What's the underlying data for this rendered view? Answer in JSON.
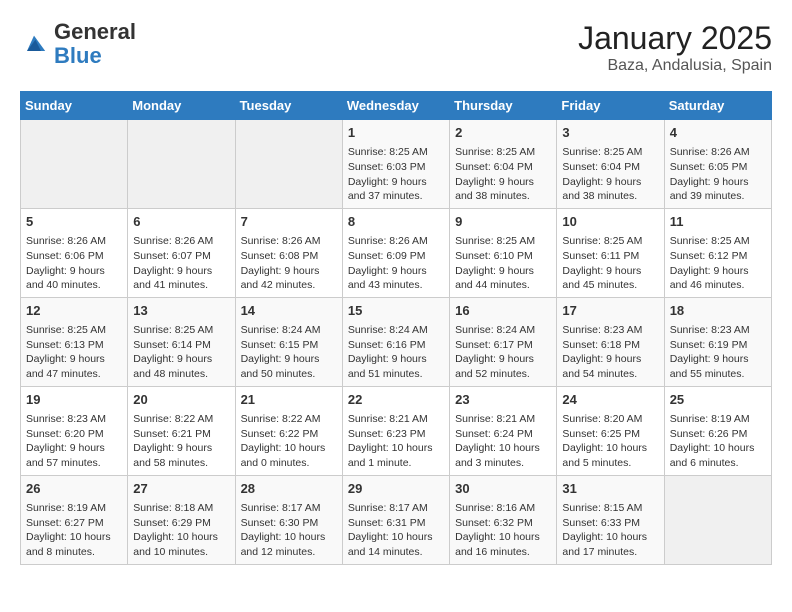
{
  "header": {
    "logo_general": "General",
    "logo_blue": "Blue",
    "title": "January 2025",
    "subtitle": "Baza, Andalusia, Spain"
  },
  "weekdays": [
    "Sunday",
    "Monday",
    "Tuesday",
    "Wednesday",
    "Thursday",
    "Friday",
    "Saturday"
  ],
  "weeks": [
    [
      {
        "day": "",
        "sunrise": "",
        "sunset": "",
        "daylight": ""
      },
      {
        "day": "",
        "sunrise": "",
        "sunset": "",
        "daylight": ""
      },
      {
        "day": "",
        "sunrise": "",
        "sunset": "",
        "daylight": ""
      },
      {
        "day": "1",
        "sunrise": "Sunrise: 8:25 AM",
        "sunset": "Sunset: 6:03 PM",
        "daylight": "Daylight: 9 hours and 37 minutes."
      },
      {
        "day": "2",
        "sunrise": "Sunrise: 8:25 AM",
        "sunset": "Sunset: 6:04 PM",
        "daylight": "Daylight: 9 hours and 38 minutes."
      },
      {
        "day": "3",
        "sunrise": "Sunrise: 8:25 AM",
        "sunset": "Sunset: 6:04 PM",
        "daylight": "Daylight: 9 hours and 38 minutes."
      },
      {
        "day": "4",
        "sunrise": "Sunrise: 8:26 AM",
        "sunset": "Sunset: 6:05 PM",
        "daylight": "Daylight: 9 hours and 39 minutes."
      }
    ],
    [
      {
        "day": "5",
        "sunrise": "Sunrise: 8:26 AM",
        "sunset": "Sunset: 6:06 PM",
        "daylight": "Daylight: 9 hours and 40 minutes."
      },
      {
        "day": "6",
        "sunrise": "Sunrise: 8:26 AM",
        "sunset": "Sunset: 6:07 PM",
        "daylight": "Daylight: 9 hours and 41 minutes."
      },
      {
        "day": "7",
        "sunrise": "Sunrise: 8:26 AM",
        "sunset": "Sunset: 6:08 PM",
        "daylight": "Daylight: 9 hours and 42 minutes."
      },
      {
        "day": "8",
        "sunrise": "Sunrise: 8:26 AM",
        "sunset": "Sunset: 6:09 PM",
        "daylight": "Daylight: 9 hours and 43 minutes."
      },
      {
        "day": "9",
        "sunrise": "Sunrise: 8:25 AM",
        "sunset": "Sunset: 6:10 PM",
        "daylight": "Daylight: 9 hours and 44 minutes."
      },
      {
        "day": "10",
        "sunrise": "Sunrise: 8:25 AM",
        "sunset": "Sunset: 6:11 PM",
        "daylight": "Daylight: 9 hours and 45 minutes."
      },
      {
        "day": "11",
        "sunrise": "Sunrise: 8:25 AM",
        "sunset": "Sunset: 6:12 PM",
        "daylight": "Daylight: 9 hours and 46 minutes."
      }
    ],
    [
      {
        "day": "12",
        "sunrise": "Sunrise: 8:25 AM",
        "sunset": "Sunset: 6:13 PM",
        "daylight": "Daylight: 9 hours and 47 minutes."
      },
      {
        "day": "13",
        "sunrise": "Sunrise: 8:25 AM",
        "sunset": "Sunset: 6:14 PM",
        "daylight": "Daylight: 9 hours and 48 minutes."
      },
      {
        "day": "14",
        "sunrise": "Sunrise: 8:24 AM",
        "sunset": "Sunset: 6:15 PM",
        "daylight": "Daylight: 9 hours and 50 minutes."
      },
      {
        "day": "15",
        "sunrise": "Sunrise: 8:24 AM",
        "sunset": "Sunset: 6:16 PM",
        "daylight": "Daylight: 9 hours and 51 minutes."
      },
      {
        "day": "16",
        "sunrise": "Sunrise: 8:24 AM",
        "sunset": "Sunset: 6:17 PM",
        "daylight": "Daylight: 9 hours and 52 minutes."
      },
      {
        "day": "17",
        "sunrise": "Sunrise: 8:23 AM",
        "sunset": "Sunset: 6:18 PM",
        "daylight": "Daylight: 9 hours and 54 minutes."
      },
      {
        "day": "18",
        "sunrise": "Sunrise: 8:23 AM",
        "sunset": "Sunset: 6:19 PM",
        "daylight": "Daylight: 9 hours and 55 minutes."
      }
    ],
    [
      {
        "day": "19",
        "sunrise": "Sunrise: 8:23 AM",
        "sunset": "Sunset: 6:20 PM",
        "daylight": "Daylight: 9 hours and 57 minutes."
      },
      {
        "day": "20",
        "sunrise": "Sunrise: 8:22 AM",
        "sunset": "Sunset: 6:21 PM",
        "daylight": "Daylight: 9 hours and 58 minutes."
      },
      {
        "day": "21",
        "sunrise": "Sunrise: 8:22 AM",
        "sunset": "Sunset: 6:22 PM",
        "daylight": "Daylight: 10 hours and 0 minutes."
      },
      {
        "day": "22",
        "sunrise": "Sunrise: 8:21 AM",
        "sunset": "Sunset: 6:23 PM",
        "daylight": "Daylight: 10 hours and 1 minute."
      },
      {
        "day": "23",
        "sunrise": "Sunrise: 8:21 AM",
        "sunset": "Sunset: 6:24 PM",
        "daylight": "Daylight: 10 hours and 3 minutes."
      },
      {
        "day": "24",
        "sunrise": "Sunrise: 8:20 AM",
        "sunset": "Sunset: 6:25 PM",
        "daylight": "Daylight: 10 hours and 5 minutes."
      },
      {
        "day": "25",
        "sunrise": "Sunrise: 8:19 AM",
        "sunset": "Sunset: 6:26 PM",
        "daylight": "Daylight: 10 hours and 6 minutes."
      }
    ],
    [
      {
        "day": "26",
        "sunrise": "Sunrise: 8:19 AM",
        "sunset": "Sunset: 6:27 PM",
        "daylight": "Daylight: 10 hours and 8 minutes."
      },
      {
        "day": "27",
        "sunrise": "Sunrise: 8:18 AM",
        "sunset": "Sunset: 6:29 PM",
        "daylight": "Daylight: 10 hours and 10 minutes."
      },
      {
        "day": "28",
        "sunrise": "Sunrise: 8:17 AM",
        "sunset": "Sunset: 6:30 PM",
        "daylight": "Daylight: 10 hours and 12 minutes."
      },
      {
        "day": "29",
        "sunrise": "Sunrise: 8:17 AM",
        "sunset": "Sunset: 6:31 PM",
        "daylight": "Daylight: 10 hours and 14 minutes."
      },
      {
        "day": "30",
        "sunrise": "Sunrise: 8:16 AM",
        "sunset": "Sunset: 6:32 PM",
        "daylight": "Daylight: 10 hours and 16 minutes."
      },
      {
        "day": "31",
        "sunrise": "Sunrise: 8:15 AM",
        "sunset": "Sunset: 6:33 PM",
        "daylight": "Daylight: 10 hours and 17 minutes."
      },
      {
        "day": "",
        "sunrise": "",
        "sunset": "",
        "daylight": ""
      }
    ]
  ]
}
